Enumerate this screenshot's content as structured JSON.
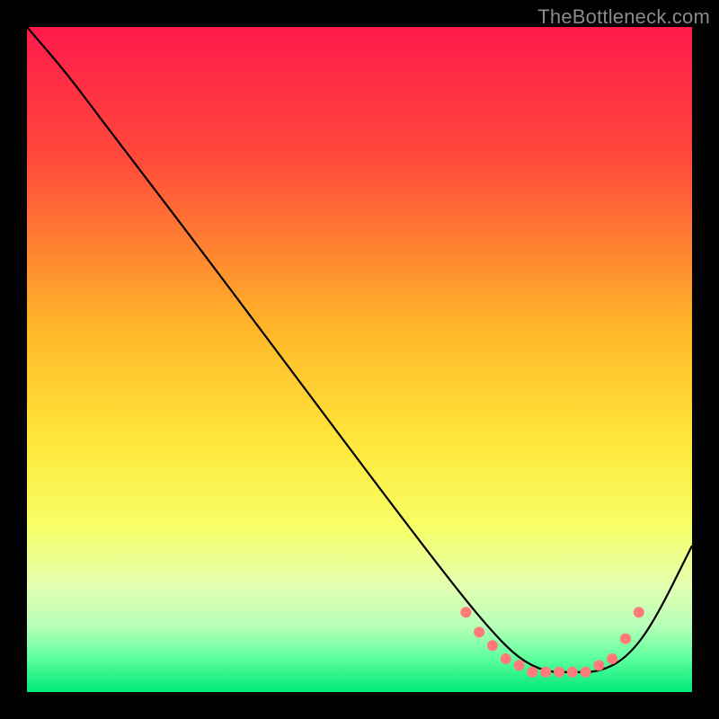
{
  "attribution": "TheBottleneck.com",
  "chart_data": {
    "type": "line",
    "title": "",
    "xlabel": "",
    "ylabel": "",
    "xlim": [
      0,
      100
    ],
    "ylim": [
      0,
      100
    ],
    "gradient_stops": [
      {
        "offset": 0,
        "color": "#ff1a4b"
      },
      {
        "offset": 20,
        "color": "#ff4a3a"
      },
      {
        "offset": 45,
        "color": "#ffb529"
      },
      {
        "offset": 62,
        "color": "#ffe63a"
      },
      {
        "offset": 75,
        "color": "#f7ff66"
      },
      {
        "offset": 84,
        "color": "#e3ffb0"
      },
      {
        "offset": 90,
        "color": "#b8ffb8"
      },
      {
        "offset": 95,
        "color": "#5cff9e"
      },
      {
        "offset": 100,
        "color": "#00e876"
      }
    ],
    "series": [
      {
        "name": "bottleneck-curve",
        "x": [
          0,
          6,
          12,
          25,
          40,
          55,
          65,
          70,
          74,
          78,
          82,
          86,
          90,
          94,
          100
        ],
        "y": [
          100,
          93,
          85,
          68,
          48,
          28,
          15,
          9,
          5,
          3,
          3,
          3,
          5,
          10,
          22
        ],
        "color": "#000000"
      }
    ],
    "markers": {
      "name": "optimal-range-dots",
      "color": "#ff7a78",
      "radius": 6,
      "x": [
        66,
        68,
        70,
        72,
        74,
        76,
        78,
        80,
        82,
        84,
        86,
        88,
        90,
        92
      ],
      "y": [
        12,
        9,
        7,
        5,
        4,
        3,
        3,
        3,
        3,
        3,
        4,
        5,
        8,
        12
      ]
    }
  }
}
